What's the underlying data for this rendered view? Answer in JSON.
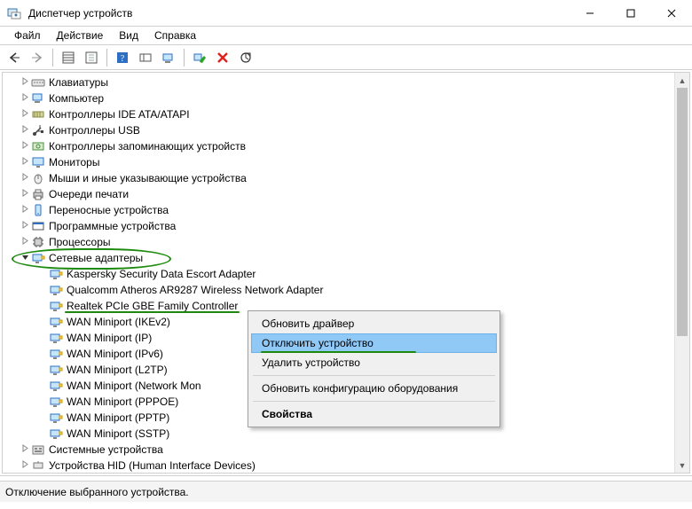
{
  "window": {
    "title": "Диспетчер устройств"
  },
  "menu": {
    "file": "Файл",
    "action": "Действие",
    "view": "Вид",
    "help": "Справка"
  },
  "tree": {
    "nodes": [
      {
        "label": "Клавиатуры",
        "depth": 1,
        "icon": "keyboard",
        "expandable": true
      },
      {
        "label": "Компьютер",
        "depth": 1,
        "icon": "computer",
        "expandable": true
      },
      {
        "label": "Контроллеры IDE ATA/ATAPI",
        "depth": 1,
        "icon": "ide",
        "expandable": true
      },
      {
        "label": "Контроллеры USB",
        "depth": 1,
        "icon": "usb",
        "expandable": true
      },
      {
        "label": "Контроллеры запоминающих устройств",
        "depth": 1,
        "icon": "storage",
        "expandable": true
      },
      {
        "label": "Мониторы",
        "depth": 1,
        "icon": "monitor",
        "expandable": true
      },
      {
        "label": "Мыши и иные указывающие устройства",
        "depth": 1,
        "icon": "mouse",
        "expandable": true
      },
      {
        "label": "Очереди печати",
        "depth": 1,
        "icon": "printer",
        "expandable": true
      },
      {
        "label": "Переносные устройства",
        "depth": 1,
        "icon": "portable",
        "expandable": true
      },
      {
        "label": "Программные устройства",
        "depth": 1,
        "icon": "software",
        "expandable": true
      },
      {
        "label": "Процессоры",
        "depth": 1,
        "icon": "cpu",
        "expandable": true
      },
      {
        "label": "Сетевые адаптеры",
        "depth": 1,
        "icon": "nic",
        "expandable": true,
        "open": true,
        "circled": true
      },
      {
        "label": "Kaspersky Security Data Escort Adapter",
        "depth": 2,
        "icon": "nic"
      },
      {
        "label": "Qualcomm Atheros AR9287 Wireless Network Adapter",
        "depth": 2,
        "icon": "nic"
      },
      {
        "label": "Realtek PCIe GBE Family Controller",
        "depth": 2,
        "icon": "nic",
        "underlined": true
      },
      {
        "label": "WAN Miniport (IKEv2)",
        "depth": 2,
        "icon": "nic"
      },
      {
        "label": "WAN Miniport (IP)",
        "depth": 2,
        "icon": "nic"
      },
      {
        "label": "WAN Miniport (IPv6)",
        "depth": 2,
        "icon": "nic"
      },
      {
        "label": "WAN Miniport (L2TP)",
        "depth": 2,
        "icon": "nic"
      },
      {
        "label": "WAN Miniport (Network Mon",
        "depth": 2,
        "icon": "nic"
      },
      {
        "label": "WAN Miniport (PPPOE)",
        "depth": 2,
        "icon": "nic"
      },
      {
        "label": "WAN Miniport (PPTP)",
        "depth": 2,
        "icon": "nic"
      },
      {
        "label": "WAN Miniport (SSTP)",
        "depth": 2,
        "icon": "nic"
      },
      {
        "label": "Системные устройства",
        "depth": 1,
        "icon": "system",
        "expandable": true
      },
      {
        "label": "Устройства HID (Human Interface Devices)",
        "depth": 1,
        "icon": "hid",
        "expandable": true
      }
    ]
  },
  "context_menu": {
    "update": "Обновить драйвер",
    "disable": "Отключить устройство",
    "remove": "Удалить устройство",
    "refresh_hw": "Обновить конфигурацию оборудования",
    "properties": "Свойства"
  },
  "status_bar": "Отключение выбранного устройства."
}
